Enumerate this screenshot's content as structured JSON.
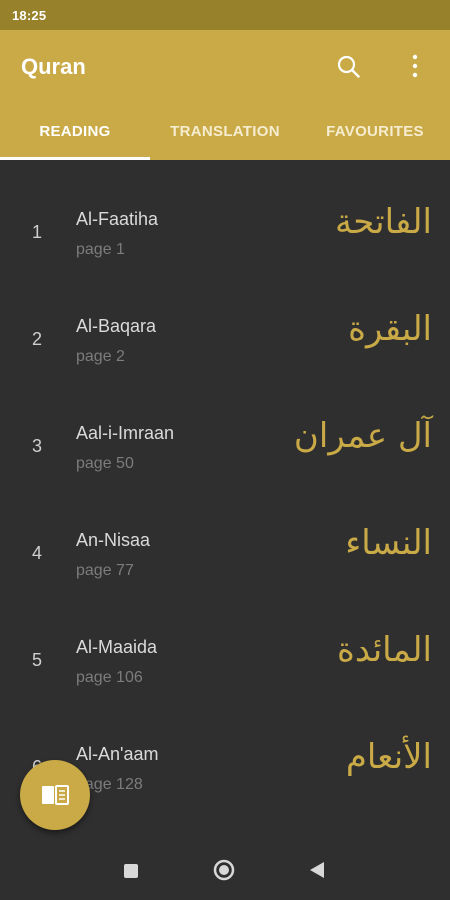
{
  "status": {
    "time": "18:25"
  },
  "header": {
    "title": "Quran"
  },
  "tabs": [
    {
      "label": "READING"
    },
    {
      "label": "TRANSLATION"
    },
    {
      "label": "FAVOURITES"
    }
  ],
  "surahs": [
    {
      "number": "1",
      "name": "Al-Faatiha",
      "page": "page 1",
      "arabic": "الفاتحة"
    },
    {
      "number": "2",
      "name": "Al-Baqara",
      "page": "page 2",
      "arabic": "البقرة"
    },
    {
      "number": "3",
      "name": "Aal-i-Imraan",
      "page": "page 50",
      "arabic": "آل عمران"
    },
    {
      "number": "4",
      "name": "An-Nisaa",
      "page": "page 77",
      "arabic": "النساء"
    },
    {
      "number": "5",
      "name": "Al-Maaida",
      "page": "page 106",
      "arabic": "المائدة"
    },
    {
      "number": "6",
      "name": "Al-An'aam",
      "page": "page 128",
      "arabic": "الأنعام"
    }
  ],
  "icons": {
    "search": "search-icon",
    "more": "more-vert-icon",
    "fab": "book-icon",
    "nav_recents": "square-icon",
    "nav_home": "circle-icon",
    "nav_back": "triangle-back-icon"
  },
  "colors": {
    "status_bar": "#98812b",
    "app_bar": "#c9aa46",
    "background": "#2f2f2f",
    "accent": "#c9aa46"
  }
}
